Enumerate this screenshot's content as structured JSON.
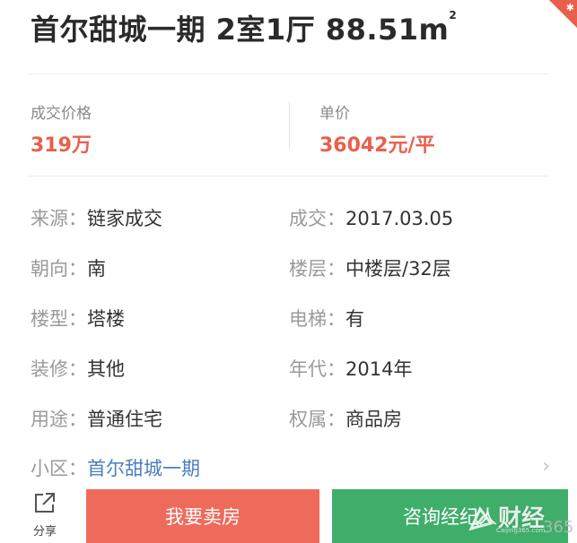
{
  "listing": {
    "title_prefix": "首尔甜城一期 2室1厅 88.51m",
    "title_unit_sup": "2"
  },
  "price": {
    "deal_label": "成交价格",
    "deal_value": "319万",
    "unit_label": "单价",
    "unit_value": "36042元/平"
  },
  "details": {
    "source_key": "来源：",
    "source_val": "链家成交",
    "deal_date_key": "成交：",
    "deal_date_val": "2017.03.05",
    "orientation_key": "朝向：",
    "orientation_val": "南",
    "floor_key": "楼层：",
    "floor_val": "中楼层/32层",
    "building_type_key": "楼型：",
    "building_type_val": "塔楼",
    "elevator_key": "电梯：",
    "elevator_val": "有",
    "decoration_key": "装修：",
    "decoration_val": "其他",
    "year_key": "年代：",
    "year_val": "2014年",
    "usage_key": "用途：",
    "usage_val": "普通住宅",
    "ownership_key": "权属：",
    "ownership_val": "商品房",
    "community_key": "小区：",
    "community_val": "首尔甜城一期"
  },
  "actions": {
    "share_label": "分享",
    "sell_label": "我要卖房",
    "consult_label": "咨询经纪人"
  },
  "watermark": {
    "brand": "财经",
    "number": "365",
    "site": "Caijing365.com"
  },
  "colors": {
    "accent_red": "#e8604c",
    "sell_button": "#ee6b5b",
    "consult_button": "#3fae6a",
    "link_blue": "#4a7fc1"
  },
  "icons": {
    "share": "share-icon",
    "chevron": "chevron-right-icon",
    "corner": "corner-badge-icon"
  }
}
